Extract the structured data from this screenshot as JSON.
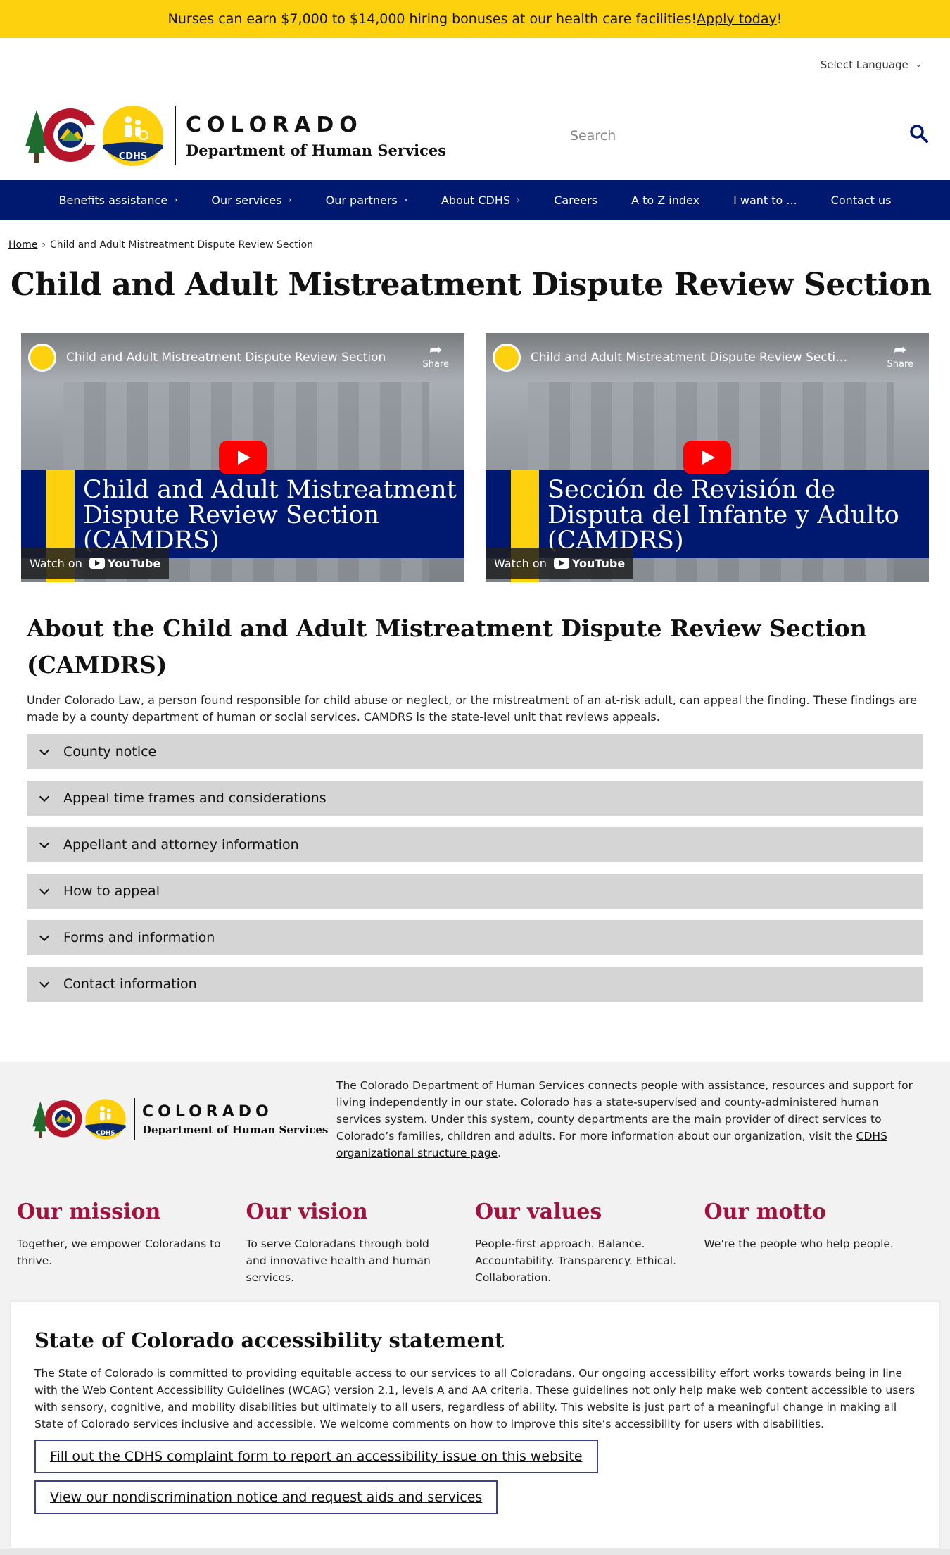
{
  "banner": {
    "text": "Nurses can earn $7,000 to $14,000 hiring bonuses at our health care facilities! ",
    "link": "Apply today",
    "suffix": "!"
  },
  "language": {
    "label": "Select Language"
  },
  "logo": {
    "state": "COLORADO",
    "department": "Department of Human Services",
    "badge": "CDHS"
  },
  "search": {
    "placeholder": "Search"
  },
  "nav": {
    "items": [
      {
        "label": "Benefits assistance",
        "has_caret": true
      },
      {
        "label": "Our services",
        "has_caret": true
      },
      {
        "label": "Our partners",
        "has_caret": true
      },
      {
        "label": "About CDHS",
        "has_caret": true
      },
      {
        "label": "Careers",
        "has_caret": false
      },
      {
        "label": "A to Z index",
        "has_caret": false
      },
      {
        "label": "I want to ...",
        "has_caret": false
      },
      {
        "label": "Contact us",
        "has_caret": false
      }
    ]
  },
  "breadcrumb": {
    "home": "Home",
    "current": "Child and Adult Mistreatment Dispute Review Section"
  },
  "page": {
    "title": "Child and Adult Mistreatment Dispute Review Section"
  },
  "videos": [
    {
      "title": "Child and Adult Mistreatment Dispute Review Section",
      "overlay": "Child and Adult Mistreatment Dispute Review Section (CAMDRS)",
      "share": "Share",
      "watch_on": "Watch on",
      "platform": "YouTube"
    },
    {
      "title": "Child and Adult Mistreatment Dispute Review Section - Spa...",
      "overlay": "Sección de Revisión de Disputa del Infante y Adulto (CAMDRS)",
      "share": "Share",
      "watch_on": "Watch on",
      "platform": "YouTube"
    }
  ],
  "about": {
    "heading": "About the Child and Adult Mistreatment Dispute Review Section (CAMDRS)",
    "body": "Under Colorado Law, a person found responsible for child abuse or neglect, or the mistreatment of an at-risk adult, can appeal the finding. These findings are made by a county department of human or social services. CAMDRS is the state-level unit that reviews appeals.",
    "accordion": [
      "County notice",
      "Appeal time frames and considerations",
      "Appellant and attorney information",
      "How to appeal",
      "Forms and information",
      "Contact information"
    ]
  },
  "footer": {
    "about_text": "The Colorado Department of Human Services connects people with assistance, resources and support for living independently in our state. Colorado has a state-supervised and county-administered human services system. Under this system, county departments are the main provider of direct services to Colorado’s families, children and adults. For more information about our organization, visit the ",
    "about_link": "CDHS organizational structure page",
    "about_end": ".",
    "pillars": [
      {
        "title": "Our mission",
        "text": "Together, we empower Coloradans to thrive."
      },
      {
        "title": "Our vision",
        "text": "To serve Coloradans through bold and innovative health and human services."
      },
      {
        "title": "Our values",
        "text": "People-first approach. Balance. Accountability. Transparency. Ethical. Collaboration."
      },
      {
        "title": "Our motto",
        "text": "We're the people who help people."
      }
    ],
    "accessibility": {
      "heading": "State of Colorado accessibility statement",
      "body": "The State of Colorado is committed to providing equitable access to our services to all Coloradans. Our ongoing accessibility effort works towards being in line with the Web Content Accessibility Guidelines (WCAG) version 2.1, levels A and AA criteria. These guidelines not only help make web content accessible to users with sensory, cognitive, and mobility disabilities but ultimately to all users, regardless of ability. This website is just part of a meaningful change in making all State of Colorado services inclusive and accessible. We welcome comments on how to improve this site’s accessibility for users with disabilities.",
      "button1": "Fill out the CDHS complaint form to report an accessibility issue on this website",
      "button2": "View our nondiscrimination notice and request aids and services"
    }
  },
  "colors": {
    "banner": "#fdd10d",
    "nav": "#001970",
    "accent_red": "#a3113e",
    "accordion": "#d5d5d5"
  }
}
